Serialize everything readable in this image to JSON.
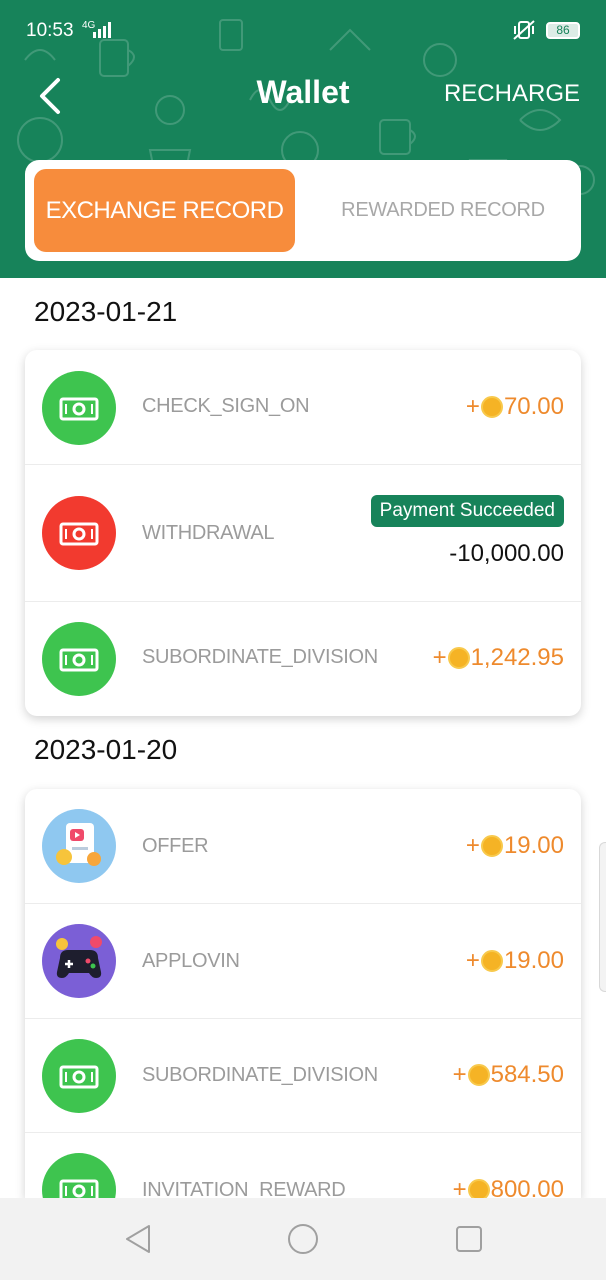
{
  "status_bar": {
    "time": "10:53",
    "network": "4G",
    "battery": "86"
  },
  "header": {
    "title": "Wallet",
    "recharge_label": "RECHARGE",
    "color": "#17835a"
  },
  "tabs": {
    "active_label": "EXCHANGE RECORD",
    "inactive_label": "REWARDED RECORD",
    "active_color": "#f78c3c"
  },
  "groups": [
    {
      "date": "2023-01-21",
      "rows": [
        {
          "icon": "banknote-icon",
          "label": "CHECK_SIGN_ON",
          "prefix": "+",
          "amount": "70.00"
        },
        {
          "icon": "banknote-icon",
          "label": "WITHDRAWAL",
          "status": "Payment Succeeded",
          "amount": "-10,000.00"
        },
        {
          "icon": "banknote-icon",
          "label": "SUBORDINATE_DIVISION",
          "prefix": "+",
          "amount": "1,242.95"
        }
      ]
    },
    {
      "date": "2023-01-20",
      "rows": [
        {
          "icon": "offer-icon",
          "label": "OFFER",
          "prefix": "+",
          "amount": "19.00"
        },
        {
          "icon": "gamepad-icon",
          "label": "APPLOVIN",
          "prefix": "+",
          "amount": "19.00"
        },
        {
          "icon": "banknote-icon",
          "label": "SUBORDINATE_DIVISION",
          "prefix": "+",
          "amount": "584.50"
        },
        {
          "icon": "banknote-icon",
          "label": "INVITATION_REWARD",
          "prefix": "+",
          "amount": "800.00"
        }
      ]
    }
  ],
  "colors": {
    "green": "#3ec44f",
    "red": "#f23a2f",
    "amount": "#ee8a2d",
    "badge": "#17835a"
  }
}
